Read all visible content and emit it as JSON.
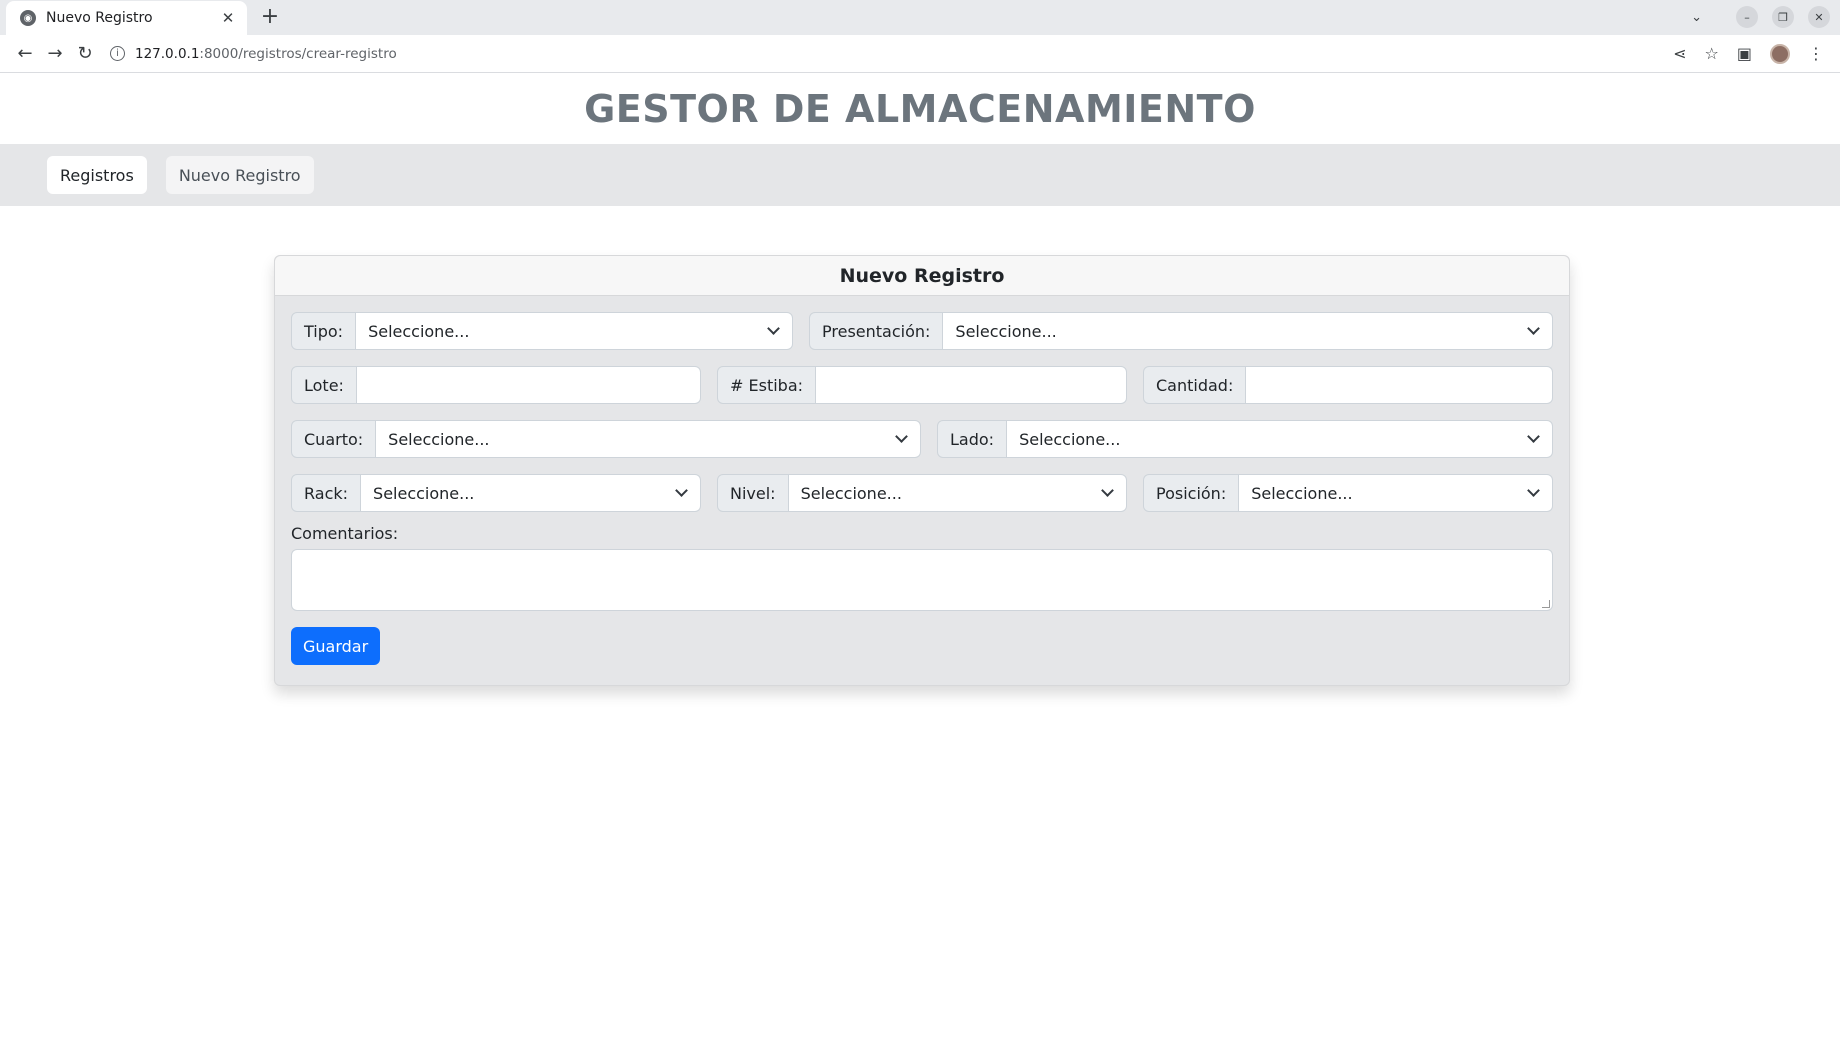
{
  "browser": {
    "tab_title": "Nuevo Registro",
    "new_tab_symbol": "+",
    "url_host": "127.0.0.1",
    "url_rest": ":8000/registros/crear-registro"
  },
  "header": {
    "title": "GESTOR DE ALMACENAMIENTO"
  },
  "nav": {
    "items": [
      {
        "label": "Registros"
      },
      {
        "label": "Nuevo Registro"
      }
    ]
  },
  "form": {
    "title": "Nuevo Registro",
    "tipo": {
      "label": "Tipo:",
      "value": "Seleccione..."
    },
    "presentacion": {
      "label": "Presentación:",
      "value": "Seleccione..."
    },
    "lote": {
      "label": "Lote:",
      "value": ""
    },
    "estiba": {
      "label": "# Estiba:",
      "value": ""
    },
    "cantidad": {
      "label": "Cantidad:",
      "value": ""
    },
    "cuarto": {
      "label": "Cuarto:",
      "value": "Seleccione..."
    },
    "lado": {
      "label": "Lado:",
      "value": "Seleccione..."
    },
    "rack": {
      "label": "Rack:",
      "value": "Seleccione..."
    },
    "nivel": {
      "label": "Nivel:",
      "value": "Seleccione..."
    },
    "posicion": {
      "label": "Posición:",
      "value": "Seleccione..."
    },
    "comentarios_label": "Comentarios:",
    "save_label": "Guardar"
  },
  "colors": {
    "primary": "#0d6efd",
    "title_gray": "#6c757d",
    "navbar_bg": "#e5e6e8"
  }
}
